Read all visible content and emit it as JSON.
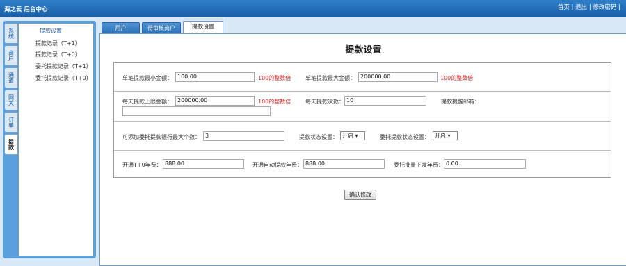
{
  "header": {
    "logo": "海之云 后台中心",
    "links": [
      "首页",
      "|",
      "退出",
      "|",
      "修改密码",
      "|"
    ]
  },
  "vtabs": [
    "系统",
    "商户",
    "通道",
    "网关",
    "订单",
    "提款"
  ],
  "menu": {
    "title": "提款设置",
    "items": [
      "提款记录（T+1）",
      "提款记录（T+0）",
      "委托提款记录（T+1）",
      "委托提款记录（T+0）"
    ]
  },
  "tabs": [
    "用户",
    "待审核商户",
    "提款设置"
  ],
  "page": {
    "title": "提款设置"
  },
  "form": {
    "min_label": "单笔提款最小金额：",
    "min_value": "100.00",
    "min_hint": "100的整数倍",
    "max_label": "单笔提款最大金额：",
    "max_value": "200000.00",
    "max_hint": "100的整数倍",
    "daily_label": "每天提款上限金额：",
    "daily_value": "200000.00",
    "daily_hint": "100的整数倍",
    "times_label": "每天提款次数：",
    "times_value": "10",
    "email_label": "提款提醒邮箱：",
    "email_value": "",
    "banks_label": "可添加委托提款银行最大个数：",
    "banks_value": "3",
    "status_label": "提款状态设置：",
    "status_value": "开启 ▾",
    "entrust_label": "委托提款状态设置：",
    "entrust_value": "开启 ▾",
    "t0_label": "开通T+0年费：",
    "t0_value": "888.00",
    "auto_label": "开通自动提款年费：",
    "auto_value": "888.00",
    "batch_label": "委托批量下发年费：",
    "batch_value": "0.00"
  },
  "submit_label": "确认修改"
}
